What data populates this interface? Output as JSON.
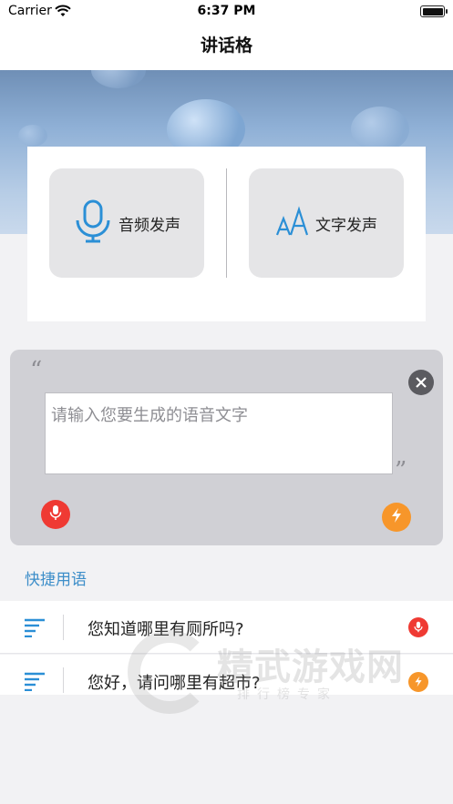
{
  "status_bar": {
    "carrier": "Carrier",
    "time": "6:37 PM",
    "battery_level": 1.0
  },
  "nav": {
    "title": "讲话格"
  },
  "modes": {
    "audio_label": "音频发声",
    "text_label": "文字发声"
  },
  "input": {
    "placeholder": "请输入您要生成的语音文字",
    "value": ""
  },
  "quick_phrases": {
    "title": "快捷用语",
    "items": [
      {
        "text": "您知道哪里有厕所吗?",
        "action_icon": "mic-icon"
      },
      {
        "text": "您好，请问哪里有超市?",
        "action_icon": "bolt-icon"
      }
    ]
  },
  "watermark": {
    "text": "精武游戏网",
    "sub": "排行榜专家"
  },
  "colors": {
    "accent_blue": "#3d8ec9",
    "record_red": "#ef3a33",
    "quick_orange": "#f7962a",
    "panel_gray": "#d0d0d5"
  }
}
